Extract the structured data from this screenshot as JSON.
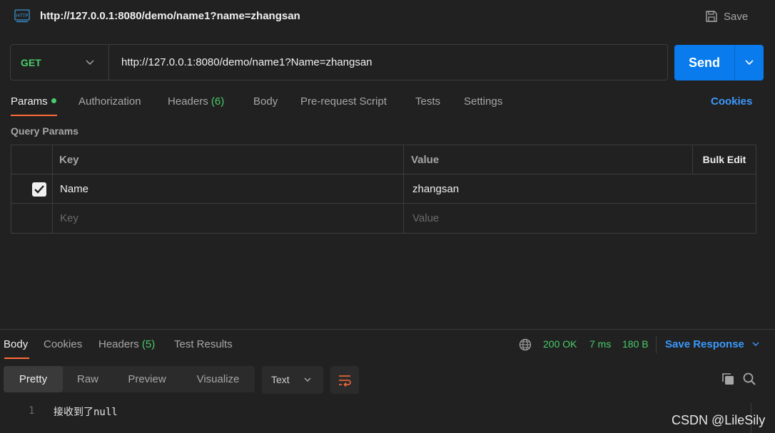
{
  "header": {
    "http_icon_text": "HTTP",
    "title": "http://127.0.0.1:8080/demo/name1?name=zhangsan",
    "save_label": "Save"
  },
  "request": {
    "method": "GET",
    "url": "http://127.0.0.1:8080/demo/name1?Name=zhangsan",
    "send_label": "Send"
  },
  "request_tabs": [
    {
      "label": "Params",
      "badge": ""
    },
    {
      "label": "Authorization",
      "badge": ""
    },
    {
      "label": "Headers",
      "badge": "(6)"
    },
    {
      "label": "Body",
      "badge": ""
    },
    {
      "label": "Pre-request Script",
      "badge": ""
    },
    {
      "label": "Tests",
      "badge": ""
    },
    {
      "label": "Settings",
      "badge": ""
    }
  ],
  "cookies_link": "Cookies",
  "query_params": {
    "title": "Query Params",
    "columns": {
      "key": "Key",
      "value": "Value",
      "bulk_edit": "Bulk Edit"
    },
    "rows": [
      {
        "checked": true,
        "key": "Name",
        "value": "zhangsan"
      }
    ],
    "placeholders": {
      "key": "Key",
      "value": "Value"
    }
  },
  "response_tabs": [
    {
      "label": "Body",
      "badge": ""
    },
    {
      "label": "Cookies",
      "badge": ""
    },
    {
      "label": "Headers",
      "badge": "(5)"
    },
    {
      "label": "Test Results",
      "badge": ""
    }
  ],
  "response_meta": {
    "status": "200 OK",
    "time": "7 ms",
    "size": "180 B",
    "save_response": "Save Response"
  },
  "format_options": [
    "Pretty",
    "Raw",
    "Preview",
    "Visualize"
  ],
  "language": "Text",
  "code_lines": [
    {
      "no": "1",
      "text": "接收到了null"
    }
  ],
  "watermark": "CSDN @LileSily",
  "colors": {
    "accent_orange": "#ff6c37",
    "send_blue": "#097bed",
    "link_blue": "#3b99fc",
    "success_green": "#49cc6a"
  }
}
